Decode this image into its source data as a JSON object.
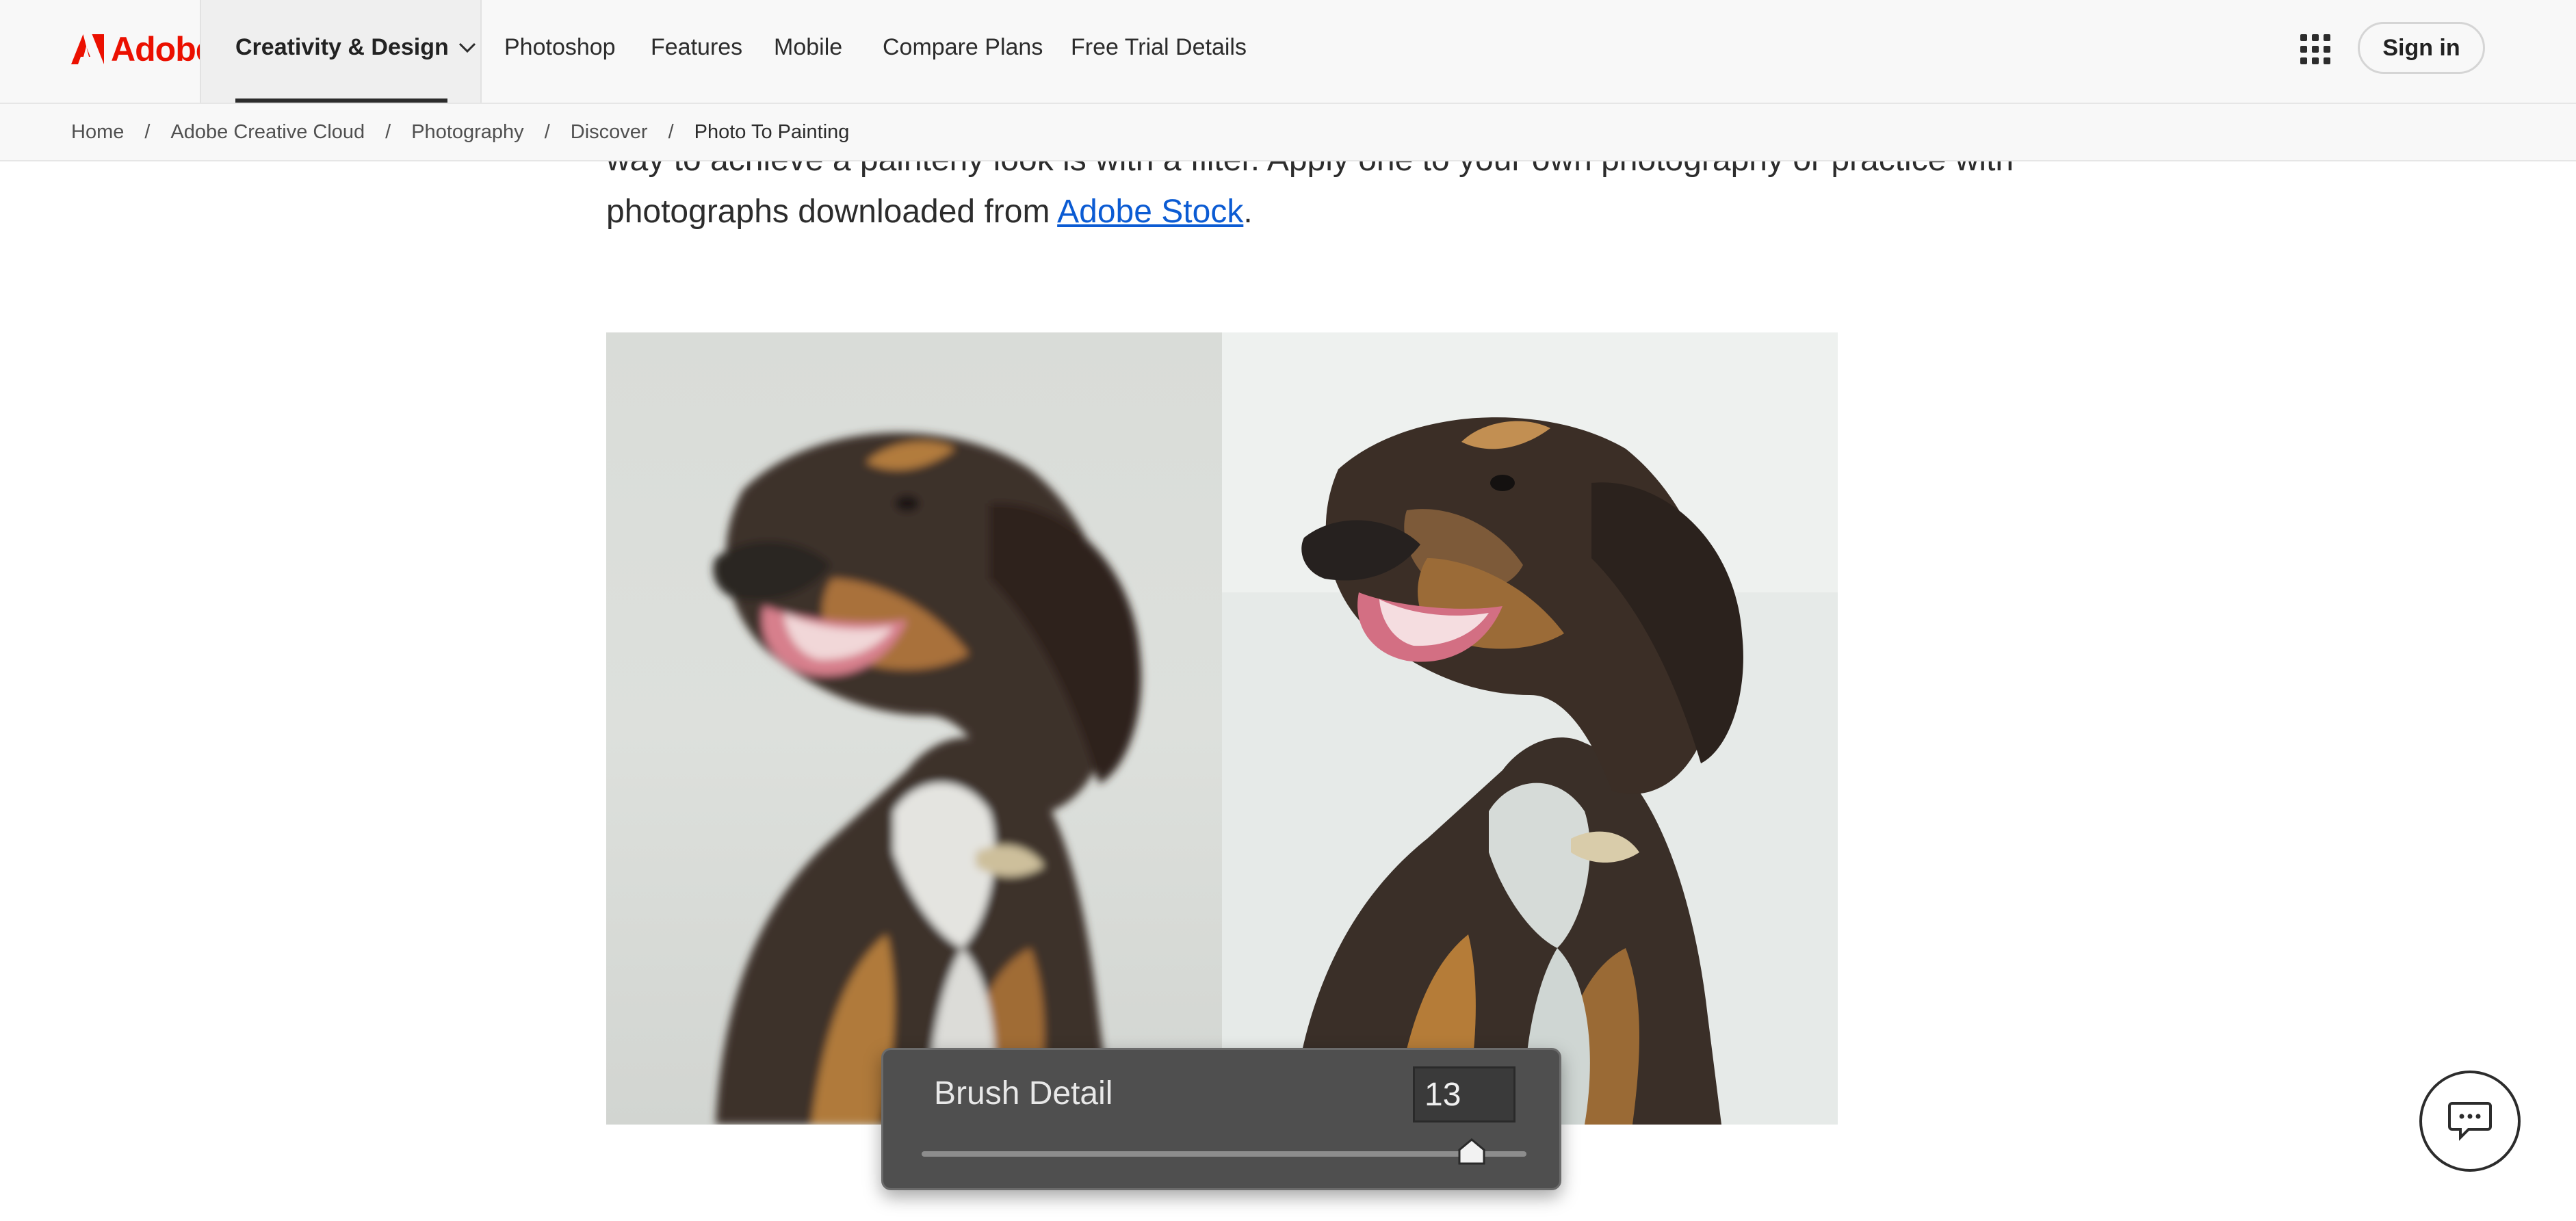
{
  "brand": {
    "name": "Adobe",
    "color": "#eb1000"
  },
  "nav": {
    "active": "Creativity & Design",
    "items": [
      "Photoshop",
      "Features",
      "Mobile",
      "Compare Plans",
      "Free Trial Details"
    ],
    "apps_icon": "grid-icon",
    "sign_in": "Sign in"
  },
  "breadcrumb": {
    "items": [
      "Home",
      "Adobe Creative Cloud",
      "Photography",
      "Discover"
    ],
    "current": "Photo To Painting"
  },
  "article": {
    "line1": "way to achieve a painterly look is with a filter. Apply one to your own photography or practice with",
    "line2_prefix": "photographs downloaded from ",
    "link_text": "Adobe Stock",
    "line2_suffix": "."
  },
  "brush_panel": {
    "label": "Brush Detail",
    "value": "13",
    "slider_fraction": 0.91
  },
  "chat": {
    "icon": "chat-icon"
  }
}
